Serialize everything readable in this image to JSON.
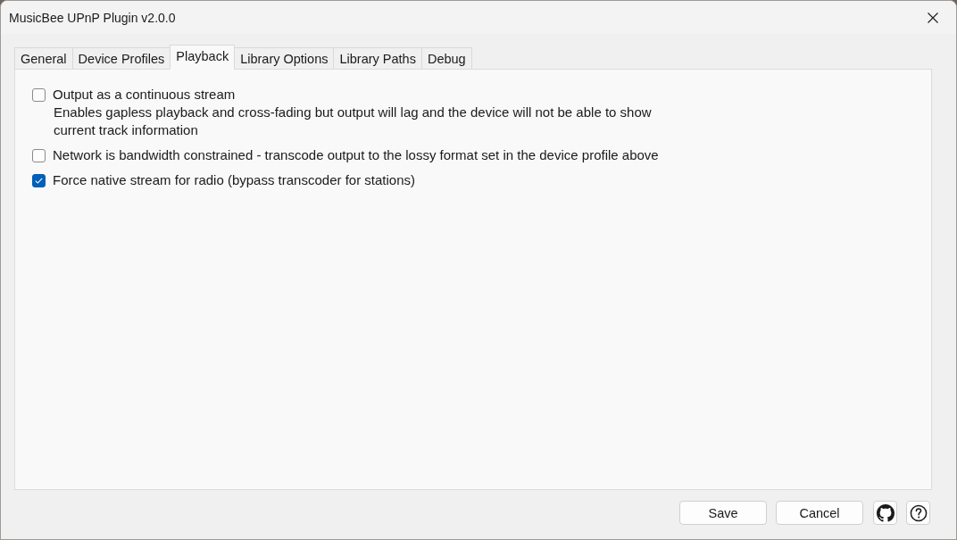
{
  "window": {
    "title": "MusicBee UPnP Plugin v2.0.0"
  },
  "tabs": [
    {
      "label": "General",
      "selected": false
    },
    {
      "label": "Device Profiles",
      "selected": false
    },
    {
      "label": "Playback",
      "selected": true
    },
    {
      "label": "Library Options",
      "selected": false
    },
    {
      "label": "Library Paths",
      "selected": false
    },
    {
      "label": "Debug",
      "selected": false
    }
  ],
  "options": [
    {
      "label": "Output as a continuous stream",
      "checked": false,
      "description": "Enables gapless playback and cross-fading but output will lag and the device will not be able to show current track information"
    },
    {
      "label": "Network is bandwidth constrained - transcode output to the lossy format set in the device profile above",
      "checked": false
    },
    {
      "label": "Force native stream for radio (bypass transcoder for stations)",
      "checked": true
    }
  ],
  "buttons": [
    {
      "label": "Save"
    },
    {
      "label": "Cancel"
    }
  ]
}
